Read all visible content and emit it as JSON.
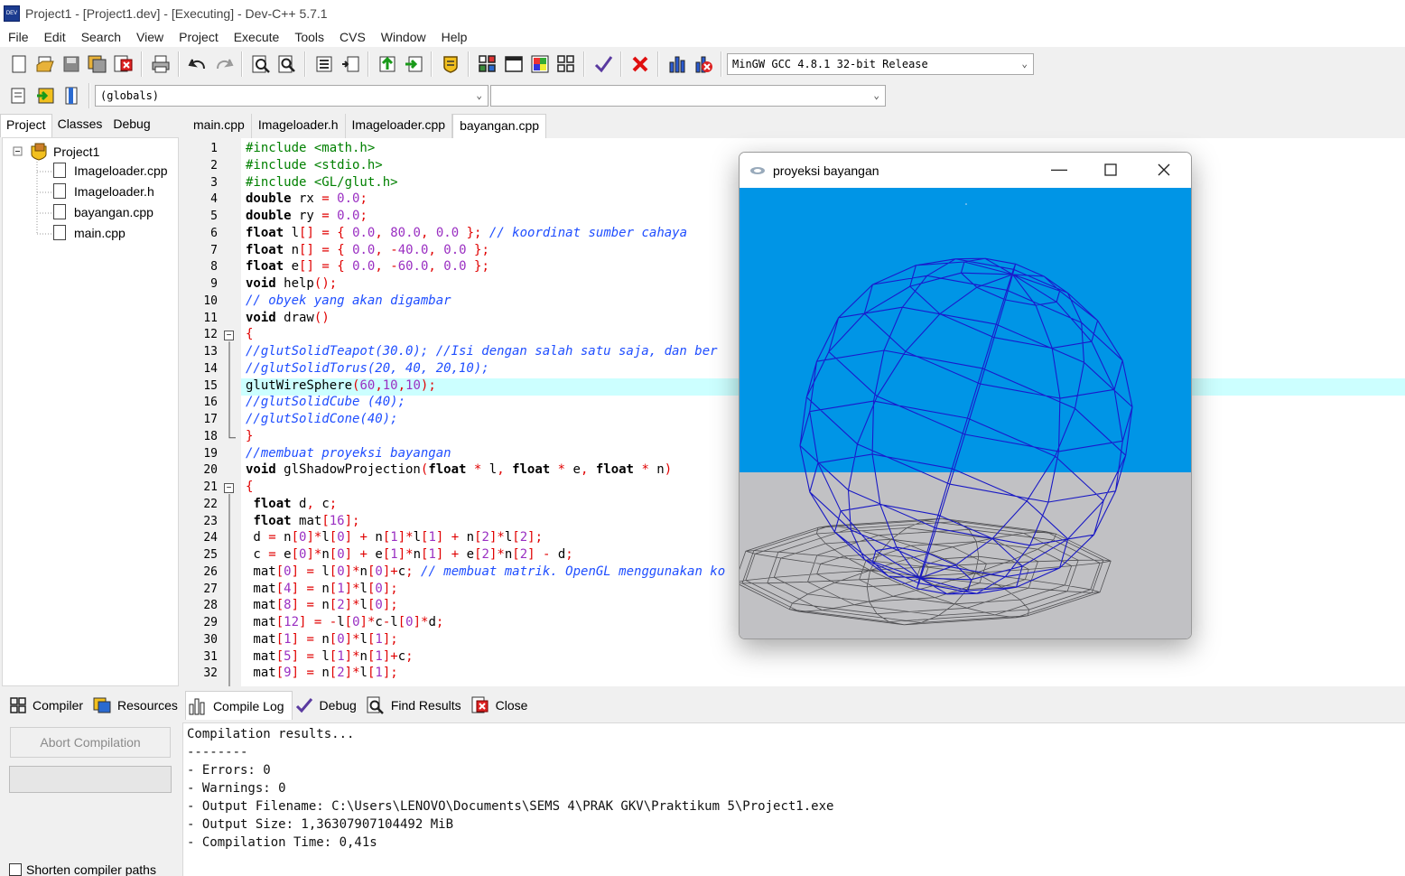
{
  "window": {
    "title": "Project1 - [Project1.dev] - [Executing] - Dev-C++ 5.7.1"
  },
  "menu": [
    "File",
    "Edit",
    "Search",
    "View",
    "Project",
    "Execute",
    "Tools",
    "CVS",
    "Window",
    "Help"
  ],
  "toolbar": {
    "compiler_select": "MinGW GCC 4.8.1 32-bit Release",
    "scope_select": "(globals)",
    "function_select": ""
  },
  "left_panel": {
    "tabs": [
      "Project",
      "Classes",
      "Debug"
    ],
    "active_tab": "Project",
    "tree": {
      "root": "Project1",
      "files": [
        "Imageloader.cpp",
        "Imageloader.h",
        "bayangan.cpp",
        "main.cpp"
      ]
    }
  },
  "editor": {
    "tabs": [
      "main.cpp",
      "Imageloader.h",
      "Imageloader.cpp",
      "bayangan.cpp"
    ],
    "active_tab": "bayangan.cpp",
    "highlighted_line": 15,
    "lines": [
      "#include <math.h>",
      "#include <stdio.h>",
      "#include <GL/glut.h>",
      "double rx = 0.0;",
      "double ry = 0.0;",
      "float l[] = { 0.0, 80.0, 0.0 }; // koordinat sumber cahaya",
      "float n[] = { 0.0, -40.0, 0.0 };",
      "float e[] = { 0.0, -60.0, 0.0 };",
      "void help();",
      "// obyek yang akan digambar",
      "void draw()",
      "{",
      "//glutSolidTeapot(30.0); //Isi dengan salah satu saja, dan ber",
      "//glutSolidTorus(20, 40, 20,10);",
      "glutWireSphere(60,10,10);",
      "//glutSolidCube (40);",
      "//glutSolidCone(40);",
      "}",
      "//membuat proyeksi bayangan",
      "void glShadowProjection(float * l, float * e, float * n)",
      "{",
      " float d, c;",
      " float mat[16];",
      " d = n[0]*l[0] + n[1]*l[1] + n[2]*l[2];",
      " c = e[0]*n[0] + e[1]*n[1] + e[2]*n[2] - d;",
      " mat[0] = l[0]*n[0]+c; // membuat matrik. OpenGL menggunakan ko",
      " mat[4] = n[1]*l[0];",
      " mat[8] = n[2]*l[0];",
      " mat[12] = -l[0]*c-l[0]*d;",
      " mat[1] = n[0]*l[1];",
      " mat[5] = l[1]*n[1]+c;",
      " mat[9] = n[2]*l[1];"
    ]
  },
  "gl_window": {
    "title": "proyeksi bayangan",
    "sky_color": "#0095e6",
    "floor_color": "#cdcdcd",
    "wire_color": "#1a1acc"
  },
  "bottom_panel": {
    "tabs": [
      "Compiler",
      "Resources",
      "Compile Log",
      "Debug",
      "Find Results",
      "Close"
    ],
    "active_tab": "Compile Log",
    "abort_label": "Abort Compilation",
    "shorten_label": "Shorten compiler paths",
    "log": [
      "Compilation results...",
      "--------",
      "- Errors: 0",
      "- Warnings: 0",
      "- Output Filename: C:\\Users\\LENOVO\\Documents\\SEMS 4\\PRAK GKV\\Praktikum 5\\Project1.exe",
      "- Output Size: 1,36307907104492 MiB",
      "- Compilation Time: 0,41s"
    ]
  }
}
